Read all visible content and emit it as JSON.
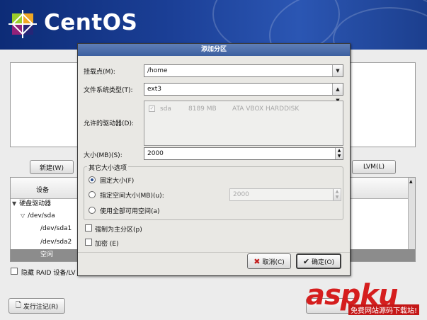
{
  "brand": {
    "name": "CentOS"
  },
  "background": {
    "new_button": "新建(W)",
    "lvm_button": "LVM(L)",
    "table_header_device": "设备",
    "tree": [
      {
        "label": "硬盘驱动器",
        "level": 0
      },
      {
        "label": "/dev/sda",
        "level": 1
      },
      {
        "label": "/dev/sda1",
        "level": 2
      },
      {
        "label": "/dev/sda2",
        "level": 2
      },
      {
        "label": "空闲",
        "level": 2
      }
    ],
    "hide_raid_label": "隐藏 RAID 设备/LV",
    "release_notes_button": "发行注记(R)"
  },
  "dialog": {
    "title": "添加分区",
    "mount_point_label": "挂载点(M):",
    "mount_point_value": "/home",
    "fs_type_label": "文件系统类型(T):",
    "fs_type_value": "ext3",
    "drives_label": "允许的驱动器(D):",
    "drive": {
      "name": "sda",
      "size": "8189 MB",
      "model": "ATA VBOX HARDDISK"
    },
    "size_label": "大小(MB)(S):",
    "size_value": "2000",
    "other_options_title": "其它大小选项",
    "opt_fixed": "固定大小(F)",
    "opt_upto": "指定空间大小(MB)(u):",
    "opt_upto_value": "2000",
    "opt_fill": "使用全部可用空间(a)",
    "force_primary": "强制为主分区(p)",
    "encrypt": "加密 (E)",
    "cancel_button": "取消(C)",
    "ok_button": "确定(O)"
  },
  "watermark": {
    "text": "aspku",
    "sub": "免费网站源码下载站!"
  },
  "colors": {
    "banner": "#1b3f96",
    "title_bar": "#4a6ca8",
    "watermark": "#d51e1e"
  }
}
